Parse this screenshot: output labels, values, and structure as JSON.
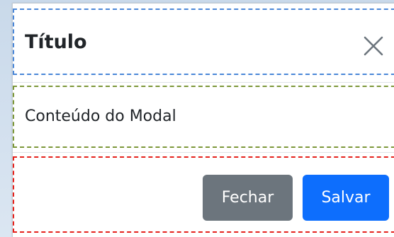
{
  "modal": {
    "title": "Título",
    "close_icon": "close-icon",
    "content": "Conteúdo do Modal",
    "buttons": {
      "close_label": "Fechar",
      "save_label": "Salvar"
    }
  },
  "colors": {
    "header_outline": "#4a87d8",
    "body_outline": "#7c9739",
    "footer_outline": "#e5211c",
    "secondary_button": "#6c757d",
    "primary_button": "#0d6efd",
    "text": "#212529"
  }
}
